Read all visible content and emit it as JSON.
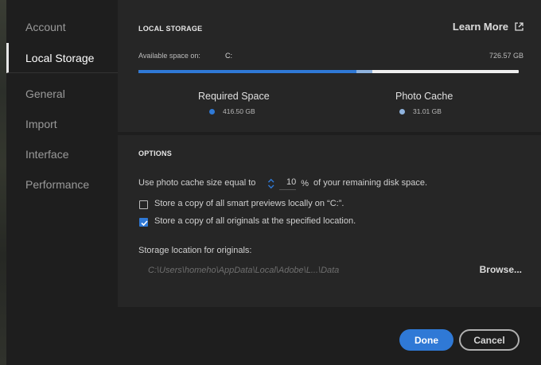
{
  "sidebar": {
    "items": [
      {
        "label": "Account"
      },
      {
        "label": "Local Storage"
      },
      {
        "label": "General"
      },
      {
        "label": "Import"
      },
      {
        "label": "Interface"
      },
      {
        "label": "Performance"
      }
    ],
    "active": "Local Storage"
  },
  "local_storage": {
    "title": "LOCAL STORAGE",
    "learn_more": "Learn More",
    "available_label": "Available space on:",
    "drive": "C:",
    "available_value": "726.57 GB",
    "usage": {
      "required_fraction": 0.573,
      "cache_fraction": 0.043
    },
    "required": {
      "label": "Required Space",
      "value": "416.50 GB",
      "color": "#2f79d6"
    },
    "cache": {
      "label": "Photo Cache",
      "value": "31.01 GB",
      "color": "#8fb3de"
    }
  },
  "options": {
    "title": "OPTIONS",
    "cache_prefix": "Use photo cache size equal to",
    "cache_value": "10",
    "cache_unit": "%",
    "cache_suffix": "of your remaining disk space.",
    "smart_previews": {
      "label": "Store a copy of all smart previews locally on “C:”.",
      "checked": false
    },
    "originals": {
      "label": "Store a copy of all originals at the specified location.",
      "checked": true
    },
    "storage_location_label": "Storage location for originals:",
    "storage_path": "C:\\Users\\homeho\\AppData\\Local\\Adobe\\L...\\Data",
    "browse": "Browse..."
  },
  "buttons": {
    "done": "Done",
    "cancel": "Cancel"
  },
  "colors": {
    "accent": "#2f79d6",
    "panel": "#262626",
    "background": "#1e1e1e"
  }
}
